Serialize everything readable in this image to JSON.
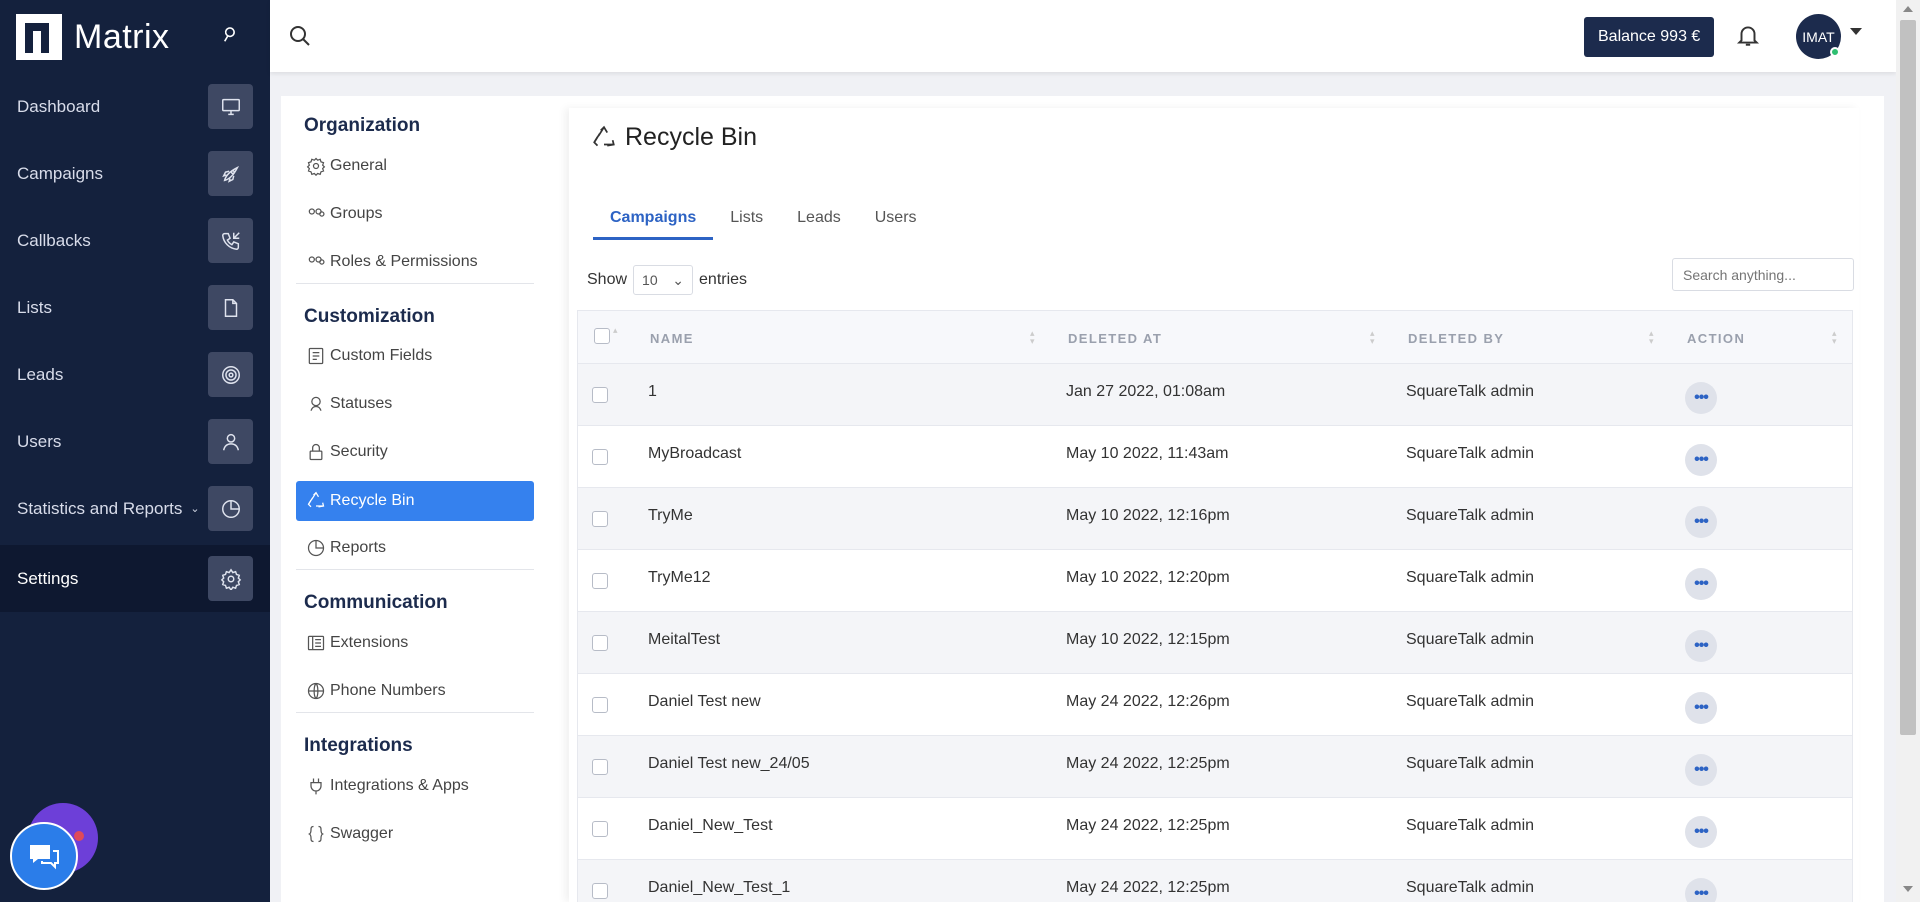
{
  "app": {
    "logo_text": "Matrix"
  },
  "sidebar": {
    "items": [
      {
        "label": "Dashboard",
        "icon": "monitor-icon"
      },
      {
        "label": "Campaigns",
        "icon": "rocket-icon"
      },
      {
        "label": "Callbacks",
        "icon": "phone-callback-icon"
      },
      {
        "label": "Lists",
        "icon": "document-icon"
      },
      {
        "label": "Leads",
        "icon": "target-icon"
      },
      {
        "label": "Users",
        "icon": "user-icon"
      },
      {
        "label": "Statistics and Reports",
        "icon": "pie-chart-icon"
      },
      {
        "label": "Settings",
        "icon": "gear-icon"
      }
    ],
    "active": "Settings"
  },
  "topbar": {
    "balance_label": "Balance 993 €",
    "avatar_initials": "IMAT"
  },
  "settings_nav": {
    "organization": "Organization",
    "general": "General",
    "groups": "Groups",
    "roles": "Roles & Permissions",
    "customization": "Customization",
    "custom_fields": "Custom Fields",
    "statuses": "Statuses",
    "security": "Security",
    "recycle_bin": "Recycle Bin",
    "reports": "Reports",
    "communication": "Communication",
    "extensions": "Extensions",
    "phone_numbers": "Phone Numbers",
    "integrations": "Integrations",
    "integrations_apps": "Integrations & Apps",
    "swagger": "Swagger"
  },
  "main": {
    "title": "Recycle Bin",
    "tabs": [
      "Campaigns",
      "Lists",
      "Leads",
      "Users"
    ],
    "active_tab": "Campaigns",
    "show_label": "Show",
    "entries_value": "10",
    "entries_label": "entries",
    "search_placeholder": "Search anything...",
    "columns": [
      "NAME",
      "DELETED AT",
      "DELETED BY",
      "ACTION"
    ],
    "rows": [
      {
        "name": "1",
        "deleted_at": "Jan 27 2022, 01:08am",
        "deleted_by": "SquareTalk admin"
      },
      {
        "name": "MyBroadcast",
        "deleted_at": "May 10 2022, 11:43am",
        "deleted_by": "SquareTalk admin"
      },
      {
        "name": "TryMe",
        "deleted_at": "May 10 2022, 12:16pm",
        "deleted_by": "SquareTalk admin"
      },
      {
        "name": "TryMe12",
        "deleted_at": "May 10 2022, 12:20pm",
        "deleted_by": "SquareTalk admin"
      },
      {
        "name": "MeitalTest",
        "deleted_at": "May 10 2022, 12:15pm",
        "deleted_by": "SquareTalk admin"
      },
      {
        "name": "Daniel Test new",
        "deleted_at": "May 24 2022, 12:26pm",
        "deleted_by": "SquareTalk admin"
      },
      {
        "name": "Daniel Test new_24/05",
        "deleted_at": "May 24 2022, 12:25pm",
        "deleted_by": "SquareTalk admin"
      },
      {
        "name": "Daniel_New_Test",
        "deleted_at": "May 24 2022, 12:25pm",
        "deleted_by": "SquareTalk admin"
      },
      {
        "name": "Daniel_New_Test_1",
        "deleted_at": "May 24 2022, 12:25pm",
        "deleted_by": "SquareTalk admin"
      }
    ],
    "action_icon": "more-dots-icon"
  }
}
